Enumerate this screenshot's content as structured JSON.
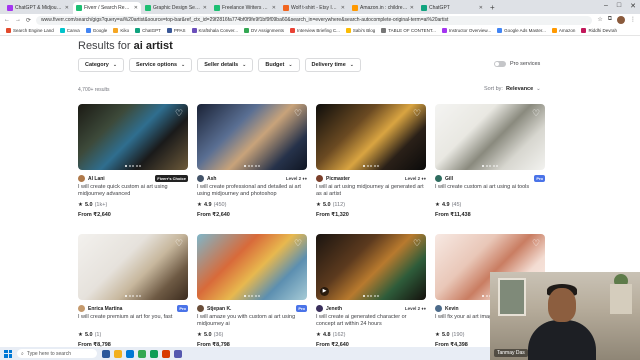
{
  "browser": {
    "tabs": [
      {
        "title": "ChatGPT & Midjourney 22 Hr...",
        "color": "#a435f0",
        "active": false
      },
      {
        "title": "Fiverr / Search Results for 'ai a...",
        "color": "#1dbf73",
        "active": true
      },
      {
        "title": "Graphic Design Services - Fiverr",
        "color": "#1dbf73",
        "active": false
      },
      {
        "title": "Freelance Writers and Expert T...",
        "color": "#1dbf73",
        "active": false
      },
      {
        "title": "Wolf t-shirt - Etsy India",
        "color": "#f1641e",
        "active": false
      },
      {
        "title": "Amazon.in : children books",
        "color": "#ff9900",
        "active": false
      },
      {
        "title": "ChatGPT",
        "color": "#10a37f",
        "active": false
      }
    ],
    "url": "www.fiverr.com/search/gigs?query=ai%20artist&source=top-bar&ref_ctx_id=29f2816fa774bf0f9fe9f1bf9f09ba60&search_in=everywhere&search-autocomplete-original-term=ai%20artist",
    "bookmarks": [
      {
        "label": "Search Engine Land",
        "color": "#e24a2c"
      },
      {
        "label": "Canva",
        "color": "#00c4cc"
      },
      {
        "label": "Google",
        "color": "#4285f4"
      },
      {
        "label": "Kiko",
        "color": "#f5a623"
      },
      {
        "label": "ChatGPT",
        "color": "#10a37f"
      },
      {
        "label": "PPAS",
        "color": "#3b5998"
      },
      {
        "label": "Kraftshala Conver...",
        "color": "#6b4fbb"
      },
      {
        "label": "DV Assignments",
        "color": "#34a853"
      },
      {
        "label": "Interview Briefing C...",
        "color": "#ea4335"
      },
      {
        "label": "Sabi's Blog",
        "color": "#fbbc05"
      },
      {
        "label": "TABLE OF CONTENT...",
        "color": "#777"
      },
      {
        "label": "Instructor Overview...",
        "color": "#a435f0"
      },
      {
        "label": "Google Ads Master...",
        "color": "#4285f4"
      },
      {
        "label": "Amazon",
        "color": "#ff9900"
      },
      {
        "label": "Riddhi Devrah",
        "color": "#c2185b"
      }
    ]
  },
  "search": {
    "results_prefix": "Results for",
    "query": "ai artist",
    "filters": [
      "Category",
      "Service options",
      "Seller details",
      "Budget",
      "Delivery time"
    ],
    "pro_services_label": "Pro services",
    "result_count": "4,700+ results",
    "sort_label": "Sort by:",
    "sort_value": "Relevance"
  },
  "gigs": [
    {
      "seller": "AI Lani",
      "badge": "Fiverr's Choice",
      "badge_type": "choice",
      "level": "",
      "title": "I will create quick custom ai art using midjourney advanced",
      "rating": "5.0",
      "reviews": "(1k+)",
      "price": "From ₹2,640",
      "avatar": "#b07a4b",
      "thumb": "linear-gradient(135deg,#1b1a14 0%,#3d4a3a 30%,#2f6e8f 50%,#1a1a1a 70%,#6d5a3a 100%)"
    },
    {
      "seller": "Ash",
      "badge": "",
      "badge_type": "",
      "level": "Level 2 ♦♦",
      "title": "I will create professional and detailed ai art using midjourney and photoshop",
      "rating": "4.9",
      "reviews": "(450)",
      "price": "From ₹2,640",
      "avatar": "#44546a",
      "thumb": "linear-gradient(135deg,#1a2236 0%,#5a6f93 35%,#c8a37a 55%,#26324a 80%,#0f1522 100%)"
    },
    {
      "seller": "Picmaster",
      "badge": "",
      "badge_type": "",
      "level": "Level 2 ♦♦",
      "title": "I will ai art using midjourney ai generated art as ai artist",
      "rating": "5.0",
      "reviews": "(112)",
      "price": "From ₹1,320",
      "avatar": "#7b3f2a",
      "thumb": "linear-gradient(135deg,#0e0d0b 0%,#6b4a22 35%,#d9a441 55%,#2a2018 75%,#0a0a0a 100%)"
    },
    {
      "seller": "Gill",
      "badge": "Pro",
      "badge_type": "pro",
      "level": "",
      "title": "I will create custom ai art using ai tools",
      "rating": "4.9",
      "reviews": "(45)",
      "price": "From ₹11,438",
      "avatar": "#2e6c5f",
      "thumb": "linear-gradient(135deg,#f4f4f2 0%,#e9e8e2 35%,#8a8a7e 55%,#d7d6cf 75%,#f2f2ef 100%)"
    },
    {
      "seller": "Enrica Martina",
      "badge": "Pro",
      "badge_type": "pro",
      "level": "",
      "title": "I will create premium ai art for you, fast",
      "rating": "5.0",
      "reviews": "(1)",
      "price": "From ₹8,798",
      "avatar": "#c59a6d",
      "thumb": "linear-gradient(135deg,#f3f1ee 0%,#e6e2dc 40%,#c7b79d 60%,#6e5a44 80%,#3b2b1e 100%)"
    },
    {
      "seller": "Stjepan K.",
      "badge": "Pro",
      "badge_type": "pro",
      "level": "",
      "title": "I will amaze you with custom ai art using midjourney ai",
      "rating": "5.0",
      "reviews": "(36)",
      "price": "From ₹8,798",
      "avatar": "#6a4e3a",
      "thumb": "linear-gradient(135deg,#7fb6c9 0%,#d86a3a 35%,#e8b84e 55%,#5c8fb0 75%,#a7cbd6 100%)"
    },
    {
      "seller": "Jeneth",
      "badge": "",
      "badge_type": "",
      "level": "Level 2 ♦♦",
      "title": "I will create ai generated character or concept art within 24 hours",
      "rating": "4.8",
      "reviews": "(162)",
      "price": "From ₹2,640",
      "avatar": "#3a2f5c",
      "thumb": "linear-gradient(135deg,#1a1410 0%,#5c3a1e 35%,#b87a2e 55%,#2e5c3a 75%,#14100c 100%)"
    },
    {
      "seller": "Kevin",
      "badge": "",
      "badge_type": "",
      "level": "",
      "title": "I will fix your ai art images",
      "rating": "5.0",
      "reviews": "(190)",
      "price": "From ₹4,398",
      "avatar": "#4c6b8a",
      "thumb": "linear-gradient(135deg,#f7e9e3 0%,#e9c7b8 35%,#c97d62 55%,#f3dcd2 75%,#fbeee9 100%)"
    }
  ],
  "taskbar": {
    "search_placeholder": "Type here to search"
  },
  "webcam": {
    "name": "Tanmay Das"
  }
}
